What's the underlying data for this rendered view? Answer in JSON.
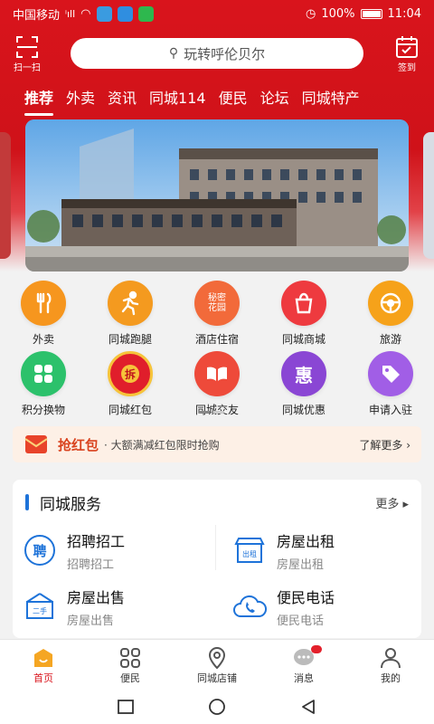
{
  "status_bar": {
    "carrier": "中国移动",
    "battery": "100%",
    "time": "11:04"
  },
  "header": {
    "scan_label": "扫一扫",
    "search_placeholder": "玩转呼伦贝尔",
    "signin_label": "签到"
  },
  "tabs": [
    "推荐",
    "外卖",
    "资讯",
    "同城114",
    "便民",
    "论坛",
    "同城特产"
  ],
  "grid": [
    {
      "label": "外卖",
      "color": "#f6961e",
      "icon": "cutlery-icon"
    },
    {
      "label": "同城跑腿",
      "color": "#f49a1f",
      "icon": "runner-icon"
    },
    {
      "label": "酒店住宿",
      "color": "#f26a3a",
      "icon": "hotel-icon",
      "icon_text": "秘密花园"
    },
    {
      "label": "同城商城",
      "color": "#ee3a3f",
      "icon": "shopping-bag-icon"
    },
    {
      "label": "旅游",
      "color": "#f6a21a",
      "icon": "steering-wheel-icon"
    },
    {
      "label": "积分换物",
      "color": "#2cc16b",
      "icon": "exchange-icon"
    },
    {
      "label": "同城红包",
      "color": "#e01e2b",
      "icon": "red-packet-icon",
      "icon_text": "拆"
    },
    {
      "label": "同城交友",
      "color": "#ee4a3a",
      "icon": "book-icon"
    },
    {
      "label": "同城优惠",
      "color": "#8a46d4",
      "icon": "discount-icon",
      "icon_text": "惠"
    },
    {
      "label": "申请入驻",
      "color": "#a15ee6",
      "icon": "tag-icon"
    }
  ],
  "promo": {
    "title": "抢红包",
    "desc": "· 大额满减红包限时抢购",
    "more": "了解更多 ›"
  },
  "services": {
    "title": "同城服务",
    "more": "更多 ▸",
    "items": [
      {
        "title": "招聘招工",
        "sub": "招聘招工",
        "icon": "recruit-icon",
        "icon_text": "聘"
      },
      {
        "title": "房屋出租",
        "sub": "房屋出租",
        "icon": "house-rent-icon",
        "icon_text": "出租"
      },
      {
        "title": "房屋出售",
        "sub": "房屋出售",
        "icon": "house-sale-icon",
        "icon_text": "二手"
      },
      {
        "title": "便民电话",
        "sub": "便民电话",
        "icon": "phone-cloud-icon"
      }
    ]
  },
  "bottom_nav": [
    {
      "label": "首页",
      "icon": "home-icon",
      "active": true
    },
    {
      "label": "便民",
      "icon": "grid-icon"
    },
    {
      "label": "同城店铺",
      "icon": "location-icon"
    },
    {
      "label": "消息",
      "icon": "message-icon"
    },
    {
      "label": "我的",
      "icon": "user-icon"
    }
  ],
  "colors": {
    "brand_red": "#d9141c",
    "accent_blue": "#1e73d9"
  }
}
